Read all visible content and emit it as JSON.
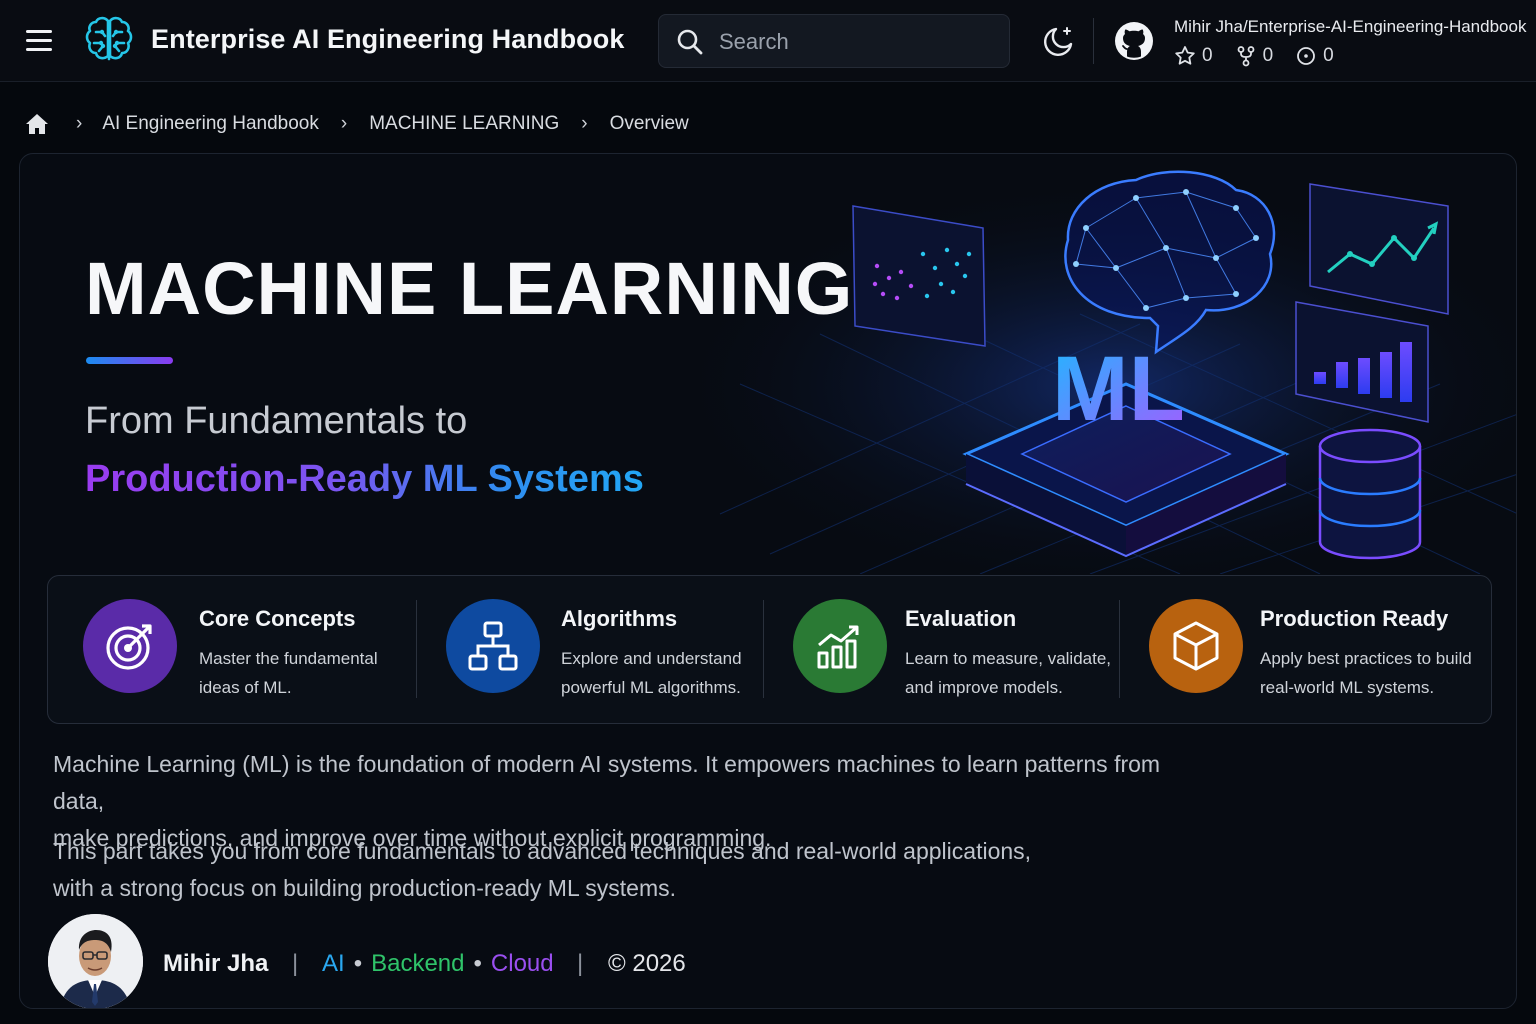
{
  "header": {
    "app_title": "Enterprise AI Engineering Handbook",
    "search_placeholder": "Search",
    "repo": {
      "name": "Mihir Jha/Enterprise-AI-Engineering-Handbook",
      "stars": "0",
      "forks": "0",
      "watchers": "0"
    }
  },
  "breadcrumb": {
    "items": [
      "AI Engineering Handbook",
      "MACHINE LEARNING",
      "Overview"
    ]
  },
  "hero": {
    "title": "MACHINE LEARNING",
    "subtitle_line1": "From Fundamentals to",
    "subtitle_line2": "Production-Ready ML Systems",
    "art_label": "ML"
  },
  "features": [
    {
      "title": "Core Concepts",
      "desc_line1": "Master the fundamental",
      "desc_line2": "ideas of ML.",
      "icon": "target-icon",
      "color": "#5a2ba8"
    },
    {
      "title": "Algorithms",
      "desc_line1": "Explore and understand",
      "desc_line2": "powerful ML algorithms.",
      "icon": "hierarchy-icon",
      "color": "#0e4aa0"
    },
    {
      "title": "Evaluation",
      "desc_line1": "Learn to measure, validate,",
      "desc_line2": "and improve models.",
      "icon": "chart-growth-icon",
      "color": "#2a7a34"
    },
    {
      "title": "Production Ready",
      "desc_line1": "Apply best practices to build",
      "desc_line2": "real-world ML systems.",
      "icon": "cube-icon",
      "color": "#b8620f"
    }
  ],
  "body": {
    "para1_line1": "Machine Learning (ML) is the foundation of modern AI systems. It empowers machines to learn patterns from data,",
    "para1_line2": "make predictions, and improve over time without explicit programming.",
    "para2_line1": "This part takes you from core fundamentals to advanced techniques and real-world applications,",
    "para2_line2": "with a strong focus on building production-ready ML systems."
  },
  "footer": {
    "author": "Mihir Jha",
    "tags": [
      "AI",
      "Backend",
      "Cloud"
    ],
    "copyright": "© 2026"
  }
}
